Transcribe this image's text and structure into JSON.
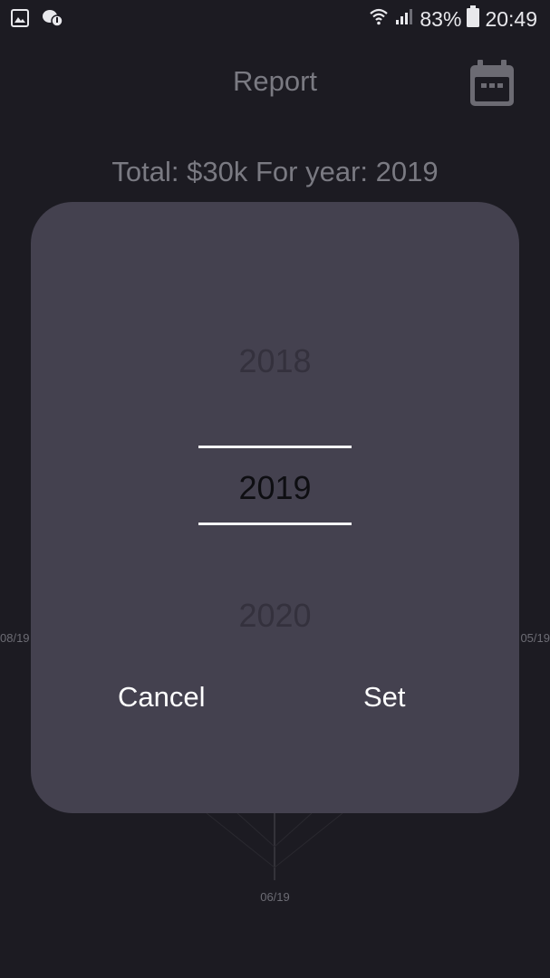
{
  "status_bar": {
    "icons_left": [
      "gallery-icon",
      "chat-notification-icon"
    ],
    "icons_right": [
      "wifi-icon",
      "cellular-signal-icon",
      "battery-icon"
    ],
    "battery_percent": "83%",
    "time": "20:49"
  },
  "header": {
    "title": "Report",
    "calendar_icon": "calendar-icon"
  },
  "summary": {
    "text": "Total: $30k For year: 2019"
  },
  "chart": {
    "labels": {
      "left": "08/19",
      "right": "05/19",
      "bottom": "06/19"
    }
  },
  "dialog": {
    "years": {
      "previous": "2018",
      "selected": "2019",
      "next": "2020"
    },
    "cancel_label": "Cancel",
    "set_label": "Set"
  },
  "colors": {
    "background": "#1c1b22",
    "dialog": "#44414f",
    "text_dimmed": "#7a7a82"
  }
}
